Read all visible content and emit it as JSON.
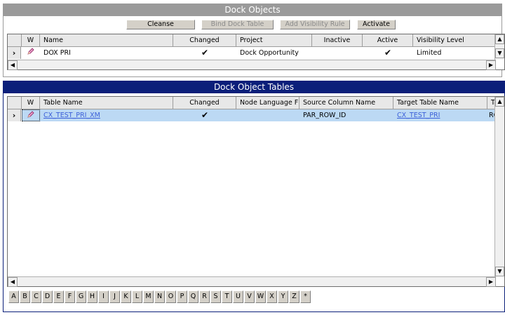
{
  "dock_objects": {
    "title": "Dock Objects",
    "buttons": {
      "cleanse": "Cleanse",
      "bind": "Bind Dock Table",
      "add_rule": "Add Visibility Rule",
      "activate": "Activate"
    },
    "columns": [
      "W",
      "Name",
      "Changed",
      "Project",
      "Inactive",
      "Active",
      "Visibility Level"
    ],
    "row": {
      "selector": "›",
      "w_icon": "pencil-icon",
      "name": "DOX PRI",
      "changed": "✔",
      "project": "Dock Opportunity",
      "inactive": "",
      "active": "✔",
      "visibility": "Limited"
    }
  },
  "dock_object_tables": {
    "title": "Dock Object Tables",
    "columns": [
      "W",
      "Table Name",
      "Changed",
      "Node Language F",
      "Source Column Name",
      "Target Table Name",
      "Tar"
    ],
    "row": {
      "selector": "›",
      "w_icon": "pencil-icon",
      "table_name": "CX_TEST_PRI_XM",
      "changed": "✔",
      "node_language": "",
      "source_column": "PAR_ROW_ID",
      "target_table": "CX_TEST_PRI",
      "target_col": "RO"
    }
  },
  "alphabet": [
    "A",
    "B",
    "C",
    "D",
    "E",
    "F",
    "G",
    "H",
    "I",
    "J",
    "K",
    "L",
    "M",
    "N",
    "O",
    "P",
    "Q",
    "R",
    "S",
    "T",
    "U",
    "V",
    "W",
    "X",
    "Y",
    "Z",
    "*"
  ],
  "colors": {
    "active_title": "#0b1f7a",
    "inactive_title": "#9a9a9a",
    "selected_row": "#bcd9f4",
    "link": "#3b5fd9"
  }
}
